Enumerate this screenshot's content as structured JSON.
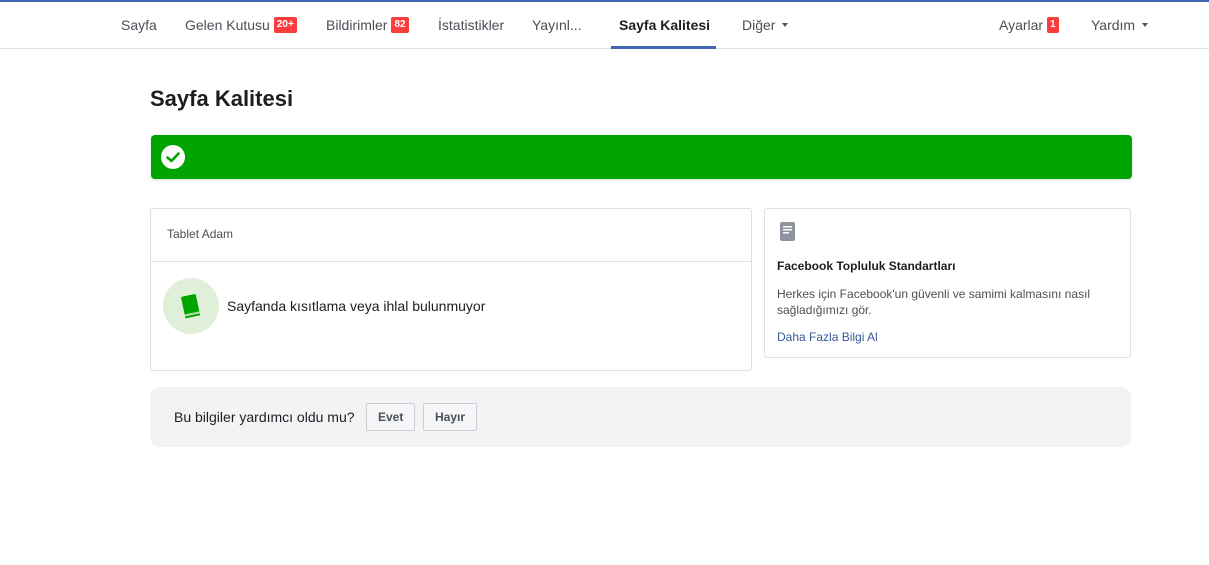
{
  "nav": {
    "items": [
      {
        "label": "Sayfa"
      },
      {
        "label": "Gelen Kutusu",
        "badge": "20+"
      },
      {
        "label": "Bildirimler",
        "badge": "82"
      },
      {
        "label": "İstatistikler"
      },
      {
        "label": "Yayınl..."
      },
      {
        "label": "Sayfa Kalitesi",
        "active": true
      },
      {
        "label": "Diğer",
        "dropdown": true
      }
    ],
    "settings": {
      "label": "Ayarlar",
      "badge": "1"
    },
    "help": {
      "label": "Yardım"
    }
  },
  "page": {
    "title": "Sayfa Kalitesi",
    "status_color": "#00a400"
  },
  "status_card": {
    "page_name": "Tablet Adam",
    "message": "Sayfanda kısıtlama veya ihlal bulunmuyor",
    "icon": "book-icon"
  },
  "standards_card": {
    "icon": "document-icon",
    "title": "Facebook Topluluk Standartları",
    "description": "Herkes için Facebook'un güvenli ve samimi kalmasını nasıl sağladığımızı gör.",
    "link": "Daha Fazla Bilgi Al"
  },
  "feedback": {
    "question": "Bu bilgiler yardımcı oldu mu?",
    "yes": "Evet",
    "no": "Hayır"
  }
}
